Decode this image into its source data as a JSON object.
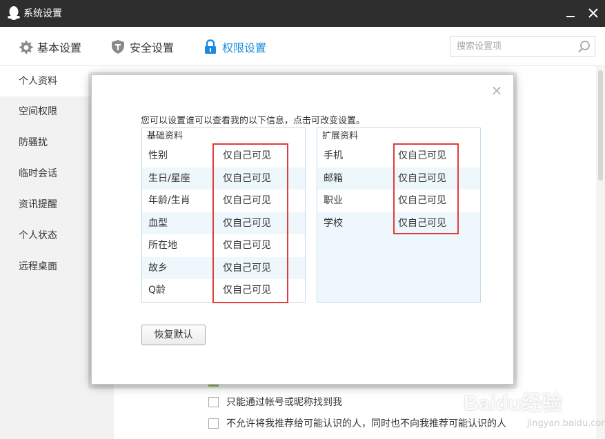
{
  "window": {
    "title": "系统设置",
    "minimize": "—",
    "close": "✕"
  },
  "tabs": [
    {
      "label": "基本设置",
      "icon": "gear-icon"
    },
    {
      "label": "安全设置",
      "icon": "shield-icon"
    },
    {
      "label": "权限设置",
      "icon": "lock-icon",
      "active": true
    }
  ],
  "search": {
    "placeholder": "搜索设置项"
  },
  "sidebar": {
    "items": [
      {
        "label": "个人资料",
        "active": true
      },
      {
        "label": "空间权限"
      },
      {
        "label": "防骚扰"
      },
      {
        "label": "临时会话"
      },
      {
        "label": "资讯提醒"
      },
      {
        "label": "个人状态"
      },
      {
        "label": "远程桌面"
      }
    ]
  },
  "main": {
    "options": [
      {
        "label": "只能通过帐号或昵称找到我",
        "checked": false
      },
      {
        "label": "不允许将我推荐给可能认识的人，同时也不向我推荐可能认识的人",
        "checked": false
      }
    ]
  },
  "dialog": {
    "close": "×",
    "description": "您可以设置谁可以查看我的以下信息，点击可改变设置。",
    "basic": {
      "header": "基础资料",
      "rows": [
        {
          "key": "性别",
          "value": "仅自己可见"
        },
        {
          "key": "生日/星座",
          "value": "仅自己可见"
        },
        {
          "key": "年龄/生肖",
          "value": "仅自己可见"
        },
        {
          "key": "血型",
          "value": "仅自己可见"
        },
        {
          "key": "所在地",
          "value": "仅自己可见"
        },
        {
          "key": "故乡",
          "value": "仅自己可见"
        },
        {
          "key": "Q龄",
          "value": "仅自己可见"
        }
      ]
    },
    "extended": {
      "header": "扩展资料",
      "rows": [
        {
          "key": "手机",
          "value": "仅自己可见"
        },
        {
          "key": "邮箱",
          "value": "仅自己可见"
        },
        {
          "key": "职业",
          "value": "仅自己可见"
        },
        {
          "key": "学校",
          "value": "仅自己可见"
        }
      ]
    },
    "restore_button": "恢复默认"
  },
  "watermark": {
    "brand": "Baidu经验",
    "url": "jingyan.baidu.com"
  },
  "colors": {
    "accent": "#1a8bde",
    "titlebar": "#2e2e2e",
    "highlight": "#e33a3a",
    "panel_bg": "#eef7fb"
  }
}
